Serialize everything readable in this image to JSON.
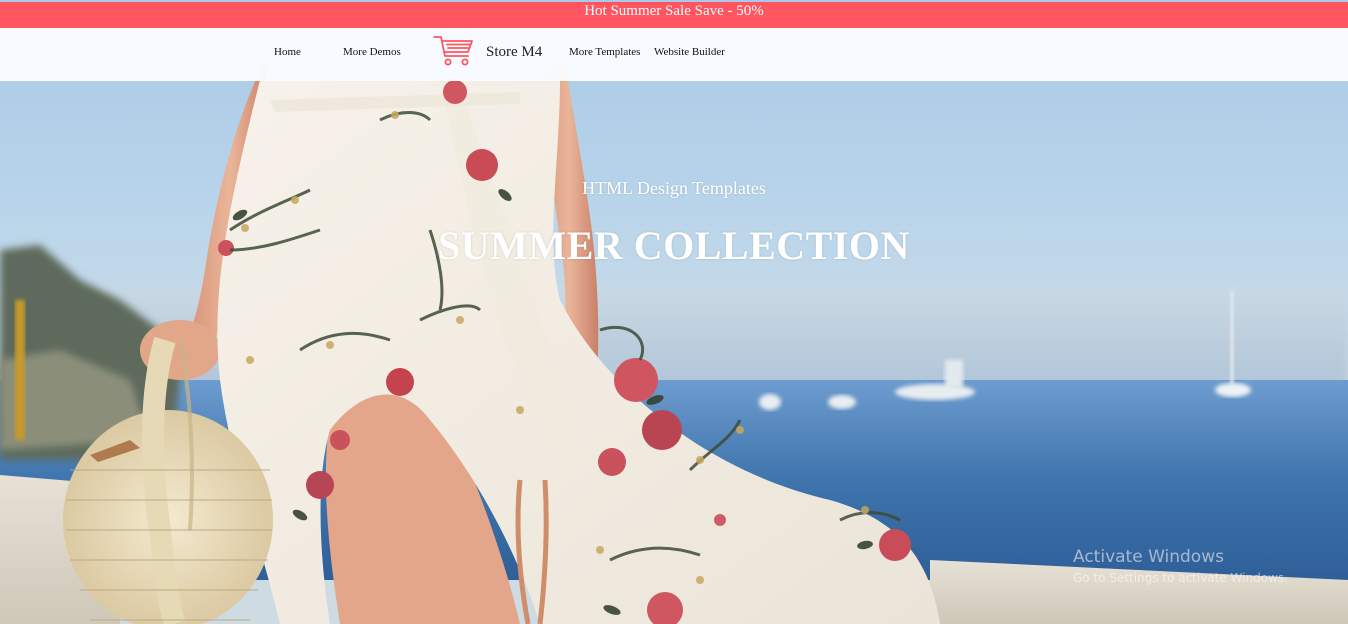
{
  "promo": {
    "text": "Hot Summer Sale Save - 50%",
    "background_color": "#ff5561"
  },
  "nav": {
    "home_label": "Home",
    "more_demos_label": "More Demos",
    "brand_name": "Store M4",
    "brand_icon": "shopping-cart-icon",
    "brand_icon_color": "#ff5561",
    "more_templates_label": "More Templates",
    "website_builder_label": "Website Builder"
  },
  "hero": {
    "subtitle": "HTML Design Templates",
    "title": "SUMMER COLLECTION"
  },
  "watermark": {
    "title": "Activate Windows",
    "subtitle": "Go to Settings to activate Windows."
  }
}
